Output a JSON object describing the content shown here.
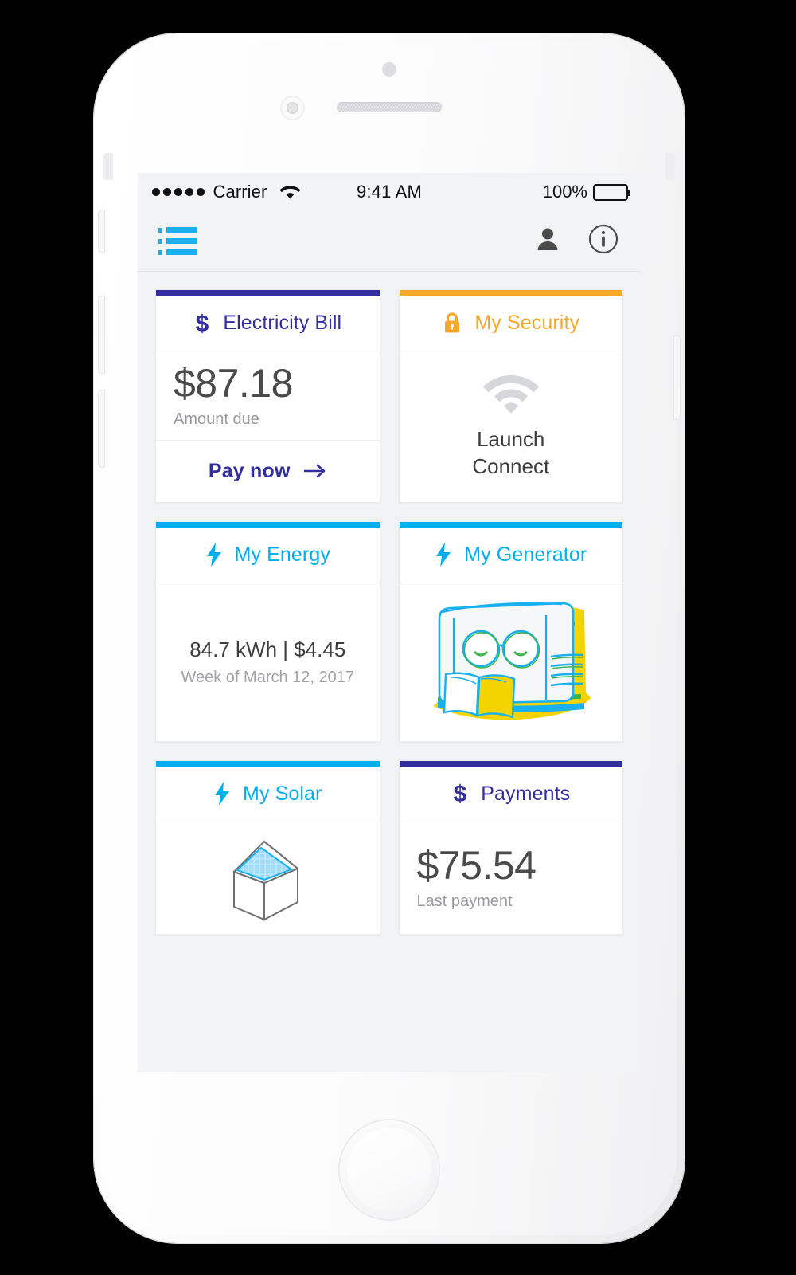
{
  "status_bar": {
    "signal_dots": 5,
    "carrier": "Carrier",
    "wifi_icon": "wifi-icon",
    "time": "9:41 AM",
    "battery_percent": "100%",
    "battery_icon": "battery-full-icon"
  },
  "nav_bar": {
    "menu_icon": "list-menu-icon",
    "account_icon": "person-icon",
    "info_icon": "info-circle-icon"
  },
  "colors": {
    "indigo": "#332E9E",
    "orange": "#F7A82B",
    "cyan": "#00AEEF",
    "screen_bg": "#f2f3f5",
    "card_bg": "#ffffff",
    "text_dark": "#4a4a4a",
    "text_muted": "#9a9a9e"
  },
  "cards": [
    {
      "id": "electricity-bill",
      "title": "Electricity Bill",
      "accent": "#332E9E",
      "icon": "dollar-sign-icon",
      "amount": "$87.18",
      "amount_label": "Amount due",
      "footer_label": "Pay now",
      "footer_icon": "arrow-right-icon"
    },
    {
      "id": "my-security",
      "title": "My Security",
      "accent": "#F7A82B",
      "icon": "lock-icon",
      "body_icon": "wifi-icon",
      "launch_line_1": "Launch",
      "launch_line_2": "Connect"
    },
    {
      "id": "my-energy",
      "title": "My Energy",
      "accent": "#00AEEF",
      "icon": "lightning-bolt-icon",
      "stat": "84.7 kWh | $4.45",
      "stat_sub": "Week of March 12, 2017"
    },
    {
      "id": "my-generator",
      "title": "My Generator",
      "accent": "#00AEEF",
      "icon": "lightning-bolt-icon",
      "illustration": "generator-reading-book-illustration"
    },
    {
      "id": "my-solar",
      "title": "My Solar",
      "accent": "#00AEEF",
      "icon": "lightning-bolt-icon",
      "illustration": "house-with-solar-panel-illustration"
    },
    {
      "id": "payments",
      "title": "Payments",
      "accent": "#332E9E",
      "icon": "dollar-sign-icon",
      "amount": "$75.54",
      "amount_label": "Last payment"
    }
  ]
}
